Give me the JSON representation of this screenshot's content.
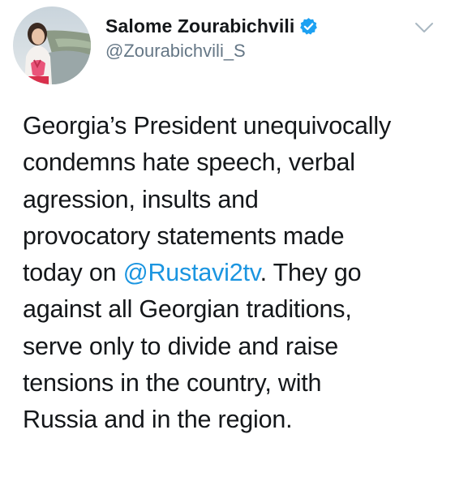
{
  "tweet": {
    "author": {
      "display_name": "Salome Zourabichvili",
      "handle": "@Zourabichvili_S",
      "verified": true
    },
    "text_lines": [
      "Georgia’s President unequivocally",
      "condemns hate speech, verbal",
      "agression, insults and",
      "provocatory statements made"
    ],
    "line5_before": "today on ",
    "mention": "@Rustavi2tv",
    "line5_after": ". They go",
    "text_lines_after": [
      "against all Georgian traditions,",
      "serve only to divide and raise",
      "tensions in the country, with",
      "Russia and in the region."
    ]
  },
  "icons": {
    "verified": "verified-badge-icon",
    "menu": "chevron-down-icon"
  },
  "colors": {
    "text": "#14171a",
    "handle": "#657786",
    "link": "#1b95e0",
    "verified": "#1da1f2",
    "chevron": "#aab8c2"
  }
}
